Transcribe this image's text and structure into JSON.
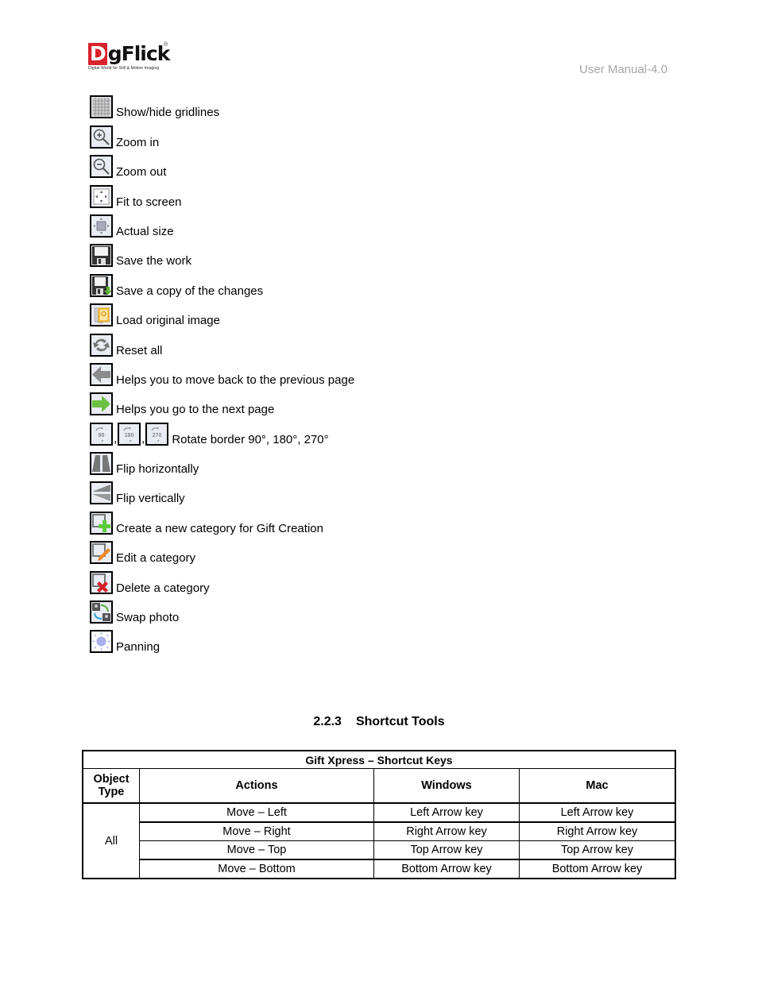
{
  "header": {
    "logo_text": "DgFlick",
    "logo_tagline": "Digital World for Still & Motion Imaging",
    "logo_registered": "®",
    "manual_version": "User Manual-4.0"
  },
  "icons": [
    {
      "icon": "gridlines-icon",
      "label": "Show/hide gridlines"
    },
    {
      "icon": "zoom-in-icon",
      "label": "Zoom in"
    },
    {
      "icon": "zoom-out-icon",
      "label": "Zoom out"
    },
    {
      "icon": "fit-to-screen-icon",
      "label": "Fit to screen"
    },
    {
      "icon": "actual-size-icon",
      "label": "Actual size"
    },
    {
      "icon": "save-icon",
      "label": "Save the work"
    },
    {
      "icon": "save-copy-icon",
      "label": "Save a copy of the changes"
    },
    {
      "icon": "load-original-icon",
      "label": "Load original image"
    },
    {
      "icon": "reset-icon",
      "label": "Reset all"
    },
    {
      "icon": "back-arrow-icon",
      "label": "Helps you to move back to the previous page"
    },
    {
      "icon": "next-arrow-icon",
      "label": "Helps you go to the next page"
    },
    {
      "icon": "rotate-icons",
      "label": "Rotate border 90°, 180°, 270°",
      "rotate_values": [
        "90",
        "180",
        "270"
      ],
      "separator": ","
    },
    {
      "icon": "flip-horizontal-icon",
      "label": "Flip horizontally"
    },
    {
      "icon": "flip-vertical-icon",
      "label": "Flip vertically"
    },
    {
      "icon": "create-category-icon",
      "label": "Create a new category for Gift Creation"
    },
    {
      "icon": "edit-category-icon",
      "label": "Edit a category"
    },
    {
      "icon": "delete-category-icon",
      "label": "Delete a category"
    },
    {
      "icon": "swap-photo-icon",
      "label": "Swap photo"
    },
    {
      "icon": "panning-icon",
      "label": "Panning"
    }
  ],
  "section": {
    "number": "2.2.3",
    "title": "Shortcut Tools"
  },
  "table": {
    "title": "Gift Xpress – Shortcut Keys",
    "headers": [
      "Object Type",
      "Actions",
      "Windows",
      "Mac"
    ],
    "object_type": "All",
    "rows": [
      {
        "action": "Move – Left",
        "windows": "Left Arrow key",
        "mac": "Left Arrow key"
      },
      {
        "action": "Move – Right",
        "windows": "Right Arrow key",
        "mac": "Right Arrow key"
      },
      {
        "action": "Move – Top",
        "windows": "Top Arrow key",
        "mac": "Top Arrow key"
      },
      {
        "action": "Move – Bottom",
        "windows": "Bottom Arrow key",
        "mac": "Bottom Arrow key"
      }
    ]
  }
}
